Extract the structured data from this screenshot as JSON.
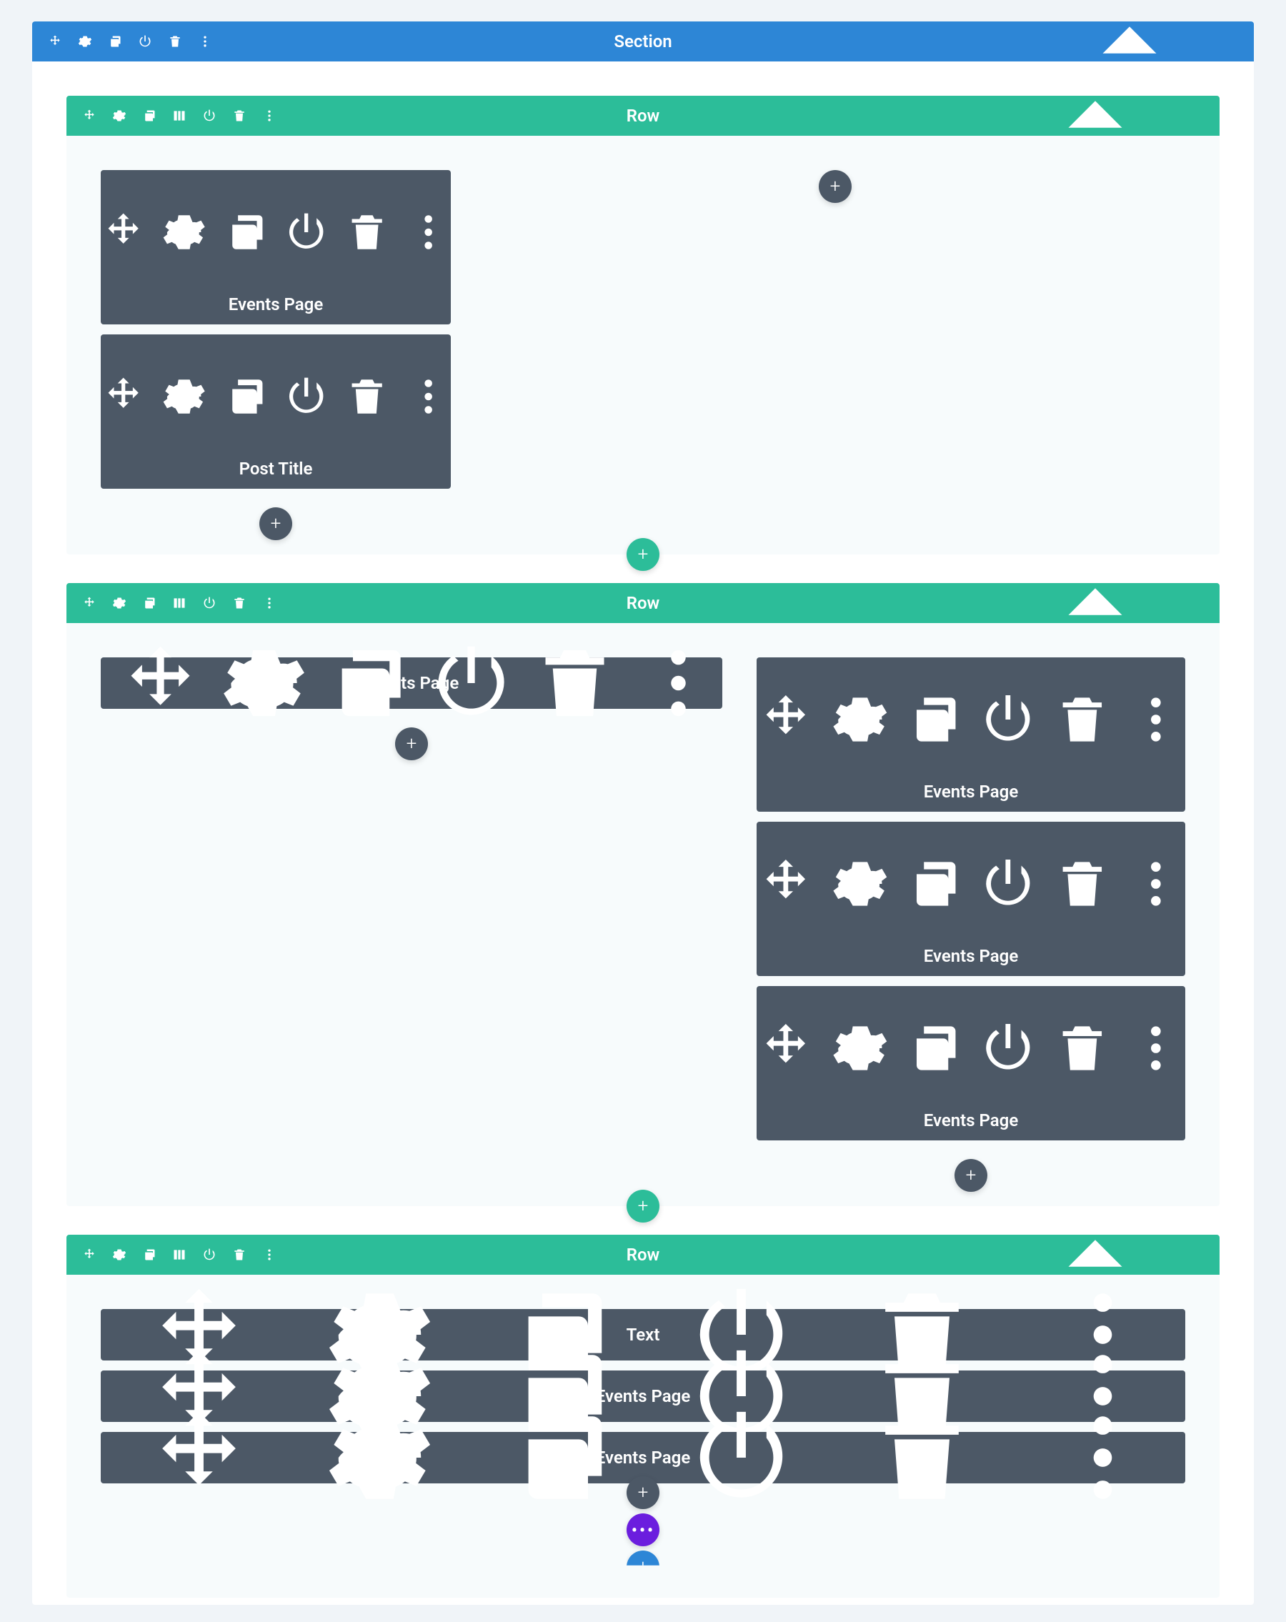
{
  "section": {
    "title": "Section",
    "rows": [
      {
        "title": "Row",
        "layout": "two-col-narrow",
        "cols": [
          {
            "modules": [
              {
                "title": "Events Page",
                "style": "center-icons"
              },
              {
                "title": "Post Title",
                "style": "center-icons"
              }
            ],
            "has_add": true
          },
          {
            "modules": [],
            "has_top_add": true
          }
        ]
      },
      {
        "title": "Row",
        "layout": "two-col-wide",
        "cols": [
          {
            "modules": [
              {
                "title": "Events Page",
                "style": "single"
              }
            ],
            "has_add": true
          },
          {
            "modules": [
              {
                "title": "Events Page",
                "style": "center-icons"
              },
              {
                "title": "Events Page",
                "style": "center-icons"
              },
              {
                "title": "Events Page",
                "style": "center-icons"
              }
            ],
            "has_add": true
          }
        ]
      },
      {
        "title": "Row",
        "layout": "one-col",
        "cols": [
          {
            "modules": [
              {
                "title": "Text",
                "style": "single"
              },
              {
                "title": "Events Page",
                "style": "single"
              },
              {
                "title": "Events Page",
                "style": "single"
              }
            ],
            "has_add": true
          }
        ]
      }
    ]
  },
  "icons": {
    "section_bar": [
      "move",
      "gear",
      "copy",
      "power",
      "trash",
      "more"
    ],
    "row_bar": [
      "move",
      "gear",
      "copy",
      "columns",
      "power",
      "trash",
      "more"
    ],
    "module": [
      "move",
      "gear",
      "copy",
      "power",
      "trash",
      "more"
    ]
  }
}
